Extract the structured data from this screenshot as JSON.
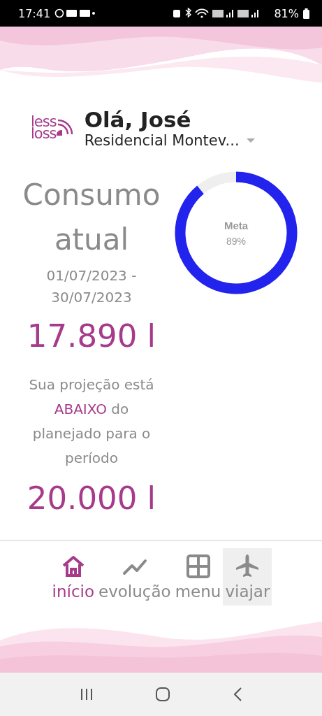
{
  "status_bar": {
    "time": "17:41",
    "battery": "81%"
  },
  "header": {
    "logo_top": "less",
    "logo_bottom": "loss",
    "greeting": "Olá, José",
    "location": "Residencial Montev..."
  },
  "consumption": {
    "title": "Consumo atual",
    "period": "01/07/2023 - 30/07/2023",
    "value": "17.890 l",
    "projection_before": "Sua projeção está ",
    "projection_highlight": "ABAIXO",
    "projection_after": " do planejado para o período",
    "planned": "20.000 l"
  },
  "goal": {
    "label": "Meta",
    "reading": "89%"
  },
  "nav": [
    {
      "label": "início",
      "kind": "home",
      "selected": true,
      "highlighted": false
    },
    {
      "label": "evolução",
      "kind": "trend",
      "selected": false,
      "highlighted": false
    },
    {
      "label": "menu",
      "kind": "grid",
      "selected": false,
      "highlighted": false
    },
    {
      "label": "viajar",
      "kind": "plane",
      "selected": false,
      "highlighted": true
    }
  ]
}
